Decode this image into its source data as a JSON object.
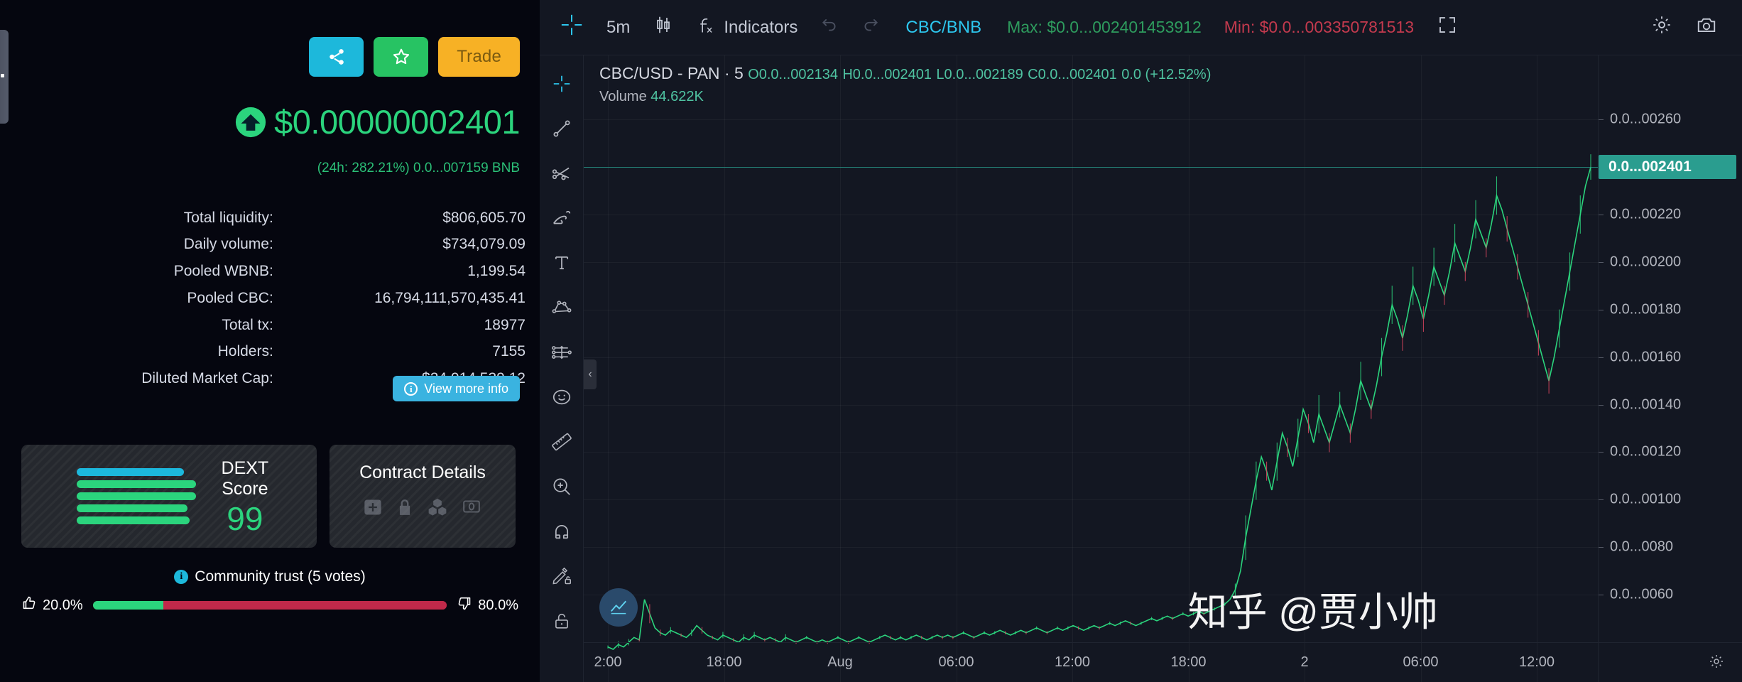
{
  "token": {
    "actions": {
      "share_label": "share-icon",
      "star_label": "star-icon",
      "trade_label": "Trade"
    },
    "price": "$0.00000002401",
    "price_change_line": "(24h: 282.21%) 0.0...007159 BNB",
    "direction": "up",
    "accent_green": "#2bd47d",
    "stats": [
      {
        "label": "Total liquidity:",
        "value": "$806,605.70"
      },
      {
        "label": "Daily volume:",
        "value": "$734,079.09"
      },
      {
        "label": "Pooled WBNB:",
        "value": "1,199.54"
      },
      {
        "label": "Pooled CBC:",
        "value": "16,794,111,570,435.41"
      },
      {
        "label": "Total tx:",
        "value": "18977"
      },
      {
        "label": "Holders:",
        "value": "7155"
      },
      {
        "label": "Diluted Market Cap:",
        "value": "$24,014,539.12"
      }
    ],
    "view_more_label": "View more info",
    "dext": {
      "title": "DEXT Score",
      "score": "99"
    },
    "contract": {
      "title": "Contract Details"
    },
    "trust": {
      "title": "Community trust (5 votes)",
      "up_pct": "20.0%",
      "down_pct": "80.0%",
      "up_fraction": 20,
      "up_color": "#2bd47d",
      "down_color": "#c0294a"
    }
  },
  "chart": {
    "toolbar": {
      "interval": "5m",
      "indicators_label": "Indicators",
      "pair": "CBC/BNB",
      "max": "Max: $0.0...002401453912",
      "min": "Min: $0.0...003350781513",
      "pair_color": "#2dc7ef",
      "max_color": "#2e9c5e",
      "min_color": "#c43a4e"
    },
    "legend": {
      "symbol": "CBC/USD - PAN",
      "interval": "5",
      "open": "O0.0...002134",
      "high": "H0.0...002401",
      "low": "L0.0...002189",
      "close": "C0.0...002401",
      "change": "0.0 (+12.52%)",
      "volume_label": "Volume",
      "volume_value": "44.622K"
    },
    "current_price_badge": "0.0...002401",
    "watermark": "知乎 @贾小帅"
  },
  "chart_data": {
    "type": "line",
    "title": "CBC/USD - PAN · 5",
    "xlabel": "",
    "ylabel": "",
    "grid": true,
    "legend_position": "top-left",
    "x_tick_labels": [
      "2:00",
      "18:00",
      "Aug",
      "06:00",
      "12:00",
      "18:00",
      "2",
      "06:00",
      "12:00"
    ],
    "y_tick_labels": [
      "0.0...00260",
      "0.0...00220",
      "0.0...00200",
      "0.0...00180",
      "0.0...00160",
      "0.0...00140",
      "0.0...00120",
      "0.0...00100",
      "0.0...0080",
      "0.0...0060"
    ],
    "y_tick_values": [
      260,
      220,
      200,
      180,
      160,
      140,
      120,
      100,
      80,
      60
    ],
    "ylim": [
      40,
      275
    ],
    "current_price": 240.1,
    "max_price": 240.1453912,
    "min_price": 33.50781513,
    "series": [
      {
        "name": "CBC/USD",
        "color": "#2bd47d",
        "values": [
          38,
          37,
          39,
          38,
          40,
          42,
          41,
          58,
          52,
          46,
          44,
          43,
          45,
          44,
          43,
          42,
          44,
          47,
          45,
          43,
          42,
          41,
          43,
          42,
          41,
          40,
          42,
          41,
          43,
          42,
          41,
          42,
          41,
          40,
          42,
          41,
          40,
          41,
          42,
          41,
          40,
          41,
          40,
          41,
          42,
          41,
          40,
          41,
          42,
          41,
          40,
          41,
          42,
          43,
          42,
          41,
          42,
          41,
          42,
          43,
          42,
          41,
          42,
          43,
          42,
          43,
          42,
          43,
          44,
          43,
          42,
          43,
          44,
          43,
          44,
          45,
          44,
          43,
          44,
          45,
          44,
          45,
          46,
          45,
          44,
          45,
          46,
          45,
          46,
          47,
          46,
          45,
          46,
          47,
          46,
          47,
          48,
          47,
          48,
          49,
          48,
          47,
          48,
          49,
          50,
          49,
          50,
          51,
          50,
          51,
          52,
          51,
          52,
          53,
          52,
          53,
          54,
          55,
          56,
          58,
          62,
          70,
          84,
          96,
          108,
          118,
          112,
          104,
          116,
          128,
          122,
          114,
          126,
          138,
          132,
          124,
          136,
          130,
          124,
          132,
          140,
          134,
          128,
          138,
          150,
          144,
          138,
          148,
          160,
          170,
          182,
          176,
          168,
          178,
          190,
          184,
          176,
          186,
          198,
          192,
          186,
          196,
          208,
          202,
          196,
          206,
          218,
          212,
          206,
          216,
          228,
          222,
          214,
          206,
          198,
          190,
          182,
          174,
          166,
          158,
          150,
          160,
          172,
          184,
          196,
          208,
          220,
          232,
          240
        ]
      }
    ],
    "volume_total": "44.622K"
  }
}
